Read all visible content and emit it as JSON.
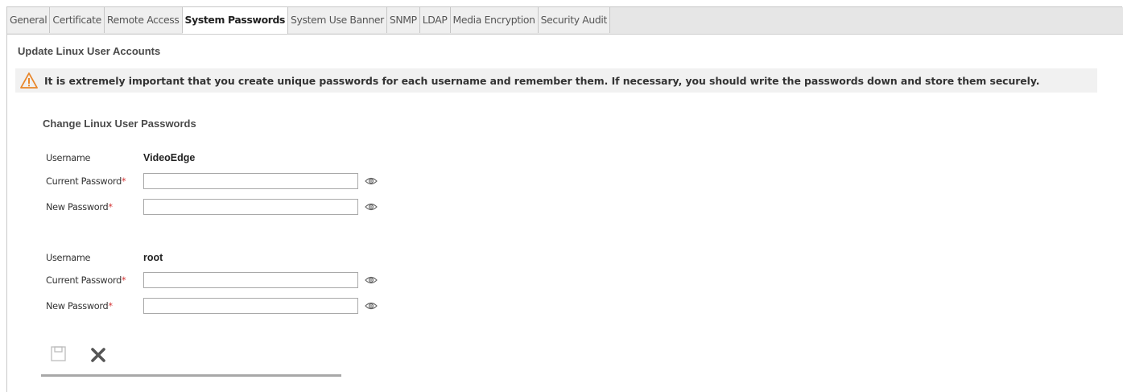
{
  "tabs": [
    {
      "label": "General",
      "active": false
    },
    {
      "label": "Certificate",
      "active": false
    },
    {
      "label": "Remote Access",
      "active": false
    },
    {
      "label": "System Passwords",
      "active": true
    },
    {
      "label": "System Use Banner",
      "active": false
    },
    {
      "label": "SNMP",
      "active": false
    },
    {
      "label": "LDAP",
      "active": false
    },
    {
      "label": "Media Encryption",
      "active": false
    },
    {
      "label": "Security Audit",
      "active": false
    }
  ],
  "section": {
    "title": "Update Linux User Accounts",
    "warning": "It is extremely important that you create unique passwords for each username and remember them. If necessary, you should write the passwords down and store them securely."
  },
  "form": {
    "subtitle": "Change Linux User Passwords",
    "accounts": [
      {
        "username_label": "Username",
        "username": "VideoEdge",
        "current_label": "Current Password",
        "new_label": "New Password",
        "current_value": "",
        "new_value": ""
      },
      {
        "username_label": "Username",
        "username": "root",
        "current_label": "Current Password",
        "new_label": "New Password",
        "current_value": "",
        "new_value": ""
      }
    ],
    "required_marker": "*"
  },
  "icons": {
    "warning": "warning-triangle-icon",
    "eye": "eye-icon",
    "save": "save-icon",
    "cancel": "close-icon"
  },
  "colors": {
    "warning_orange": "#e8862a",
    "required_red": "#d32f2f",
    "tab_bar": "#e6e6e6",
    "warning_bg": "#f1f1f1"
  }
}
